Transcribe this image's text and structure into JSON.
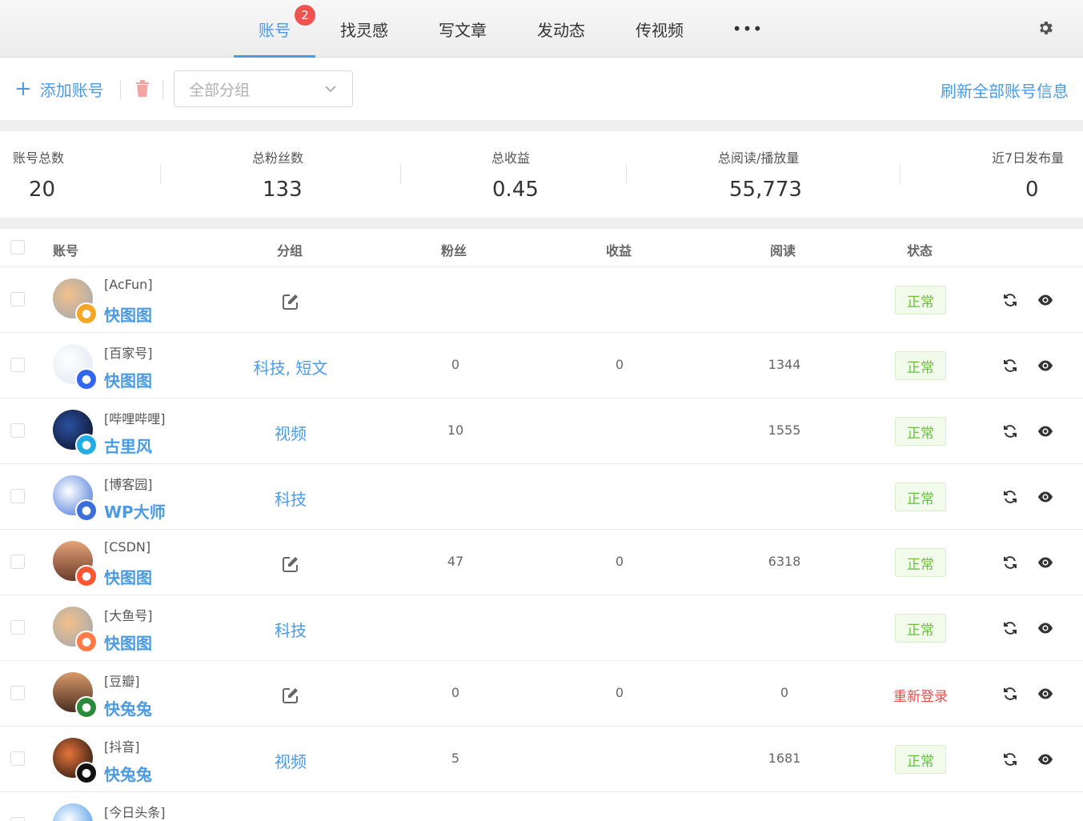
{
  "colors": {
    "accent": "#4a9be4",
    "badge": "#ef5350",
    "ok": "#67c23a",
    "danger": "#e05050"
  },
  "tabs": [
    {
      "label": "账号",
      "badge": "2"
    },
    {
      "label": "找灵感"
    },
    {
      "label": "写文章"
    },
    {
      "label": "发动态"
    },
    {
      "label": "传视频"
    },
    {
      "label": "•••"
    }
  ],
  "toolbar": {
    "add_label": "添加账号",
    "group_select": "全部分组",
    "refresh_all": "刷新全部账号信息"
  },
  "stats": [
    {
      "label": "账号总数",
      "value": "20"
    },
    {
      "label": "总粉丝数",
      "value": "133"
    },
    {
      "label": "总收益",
      "value": "0.45"
    },
    {
      "label": "总阅读/播放量",
      "value": "55,773"
    },
    {
      "label": "近7日发布量",
      "value": "0"
    }
  ],
  "table": {
    "headers": {
      "account": "账号",
      "group": "分组",
      "fans": "粉丝",
      "income": "收益",
      "reads": "阅读",
      "status": "状态"
    },
    "rows": [
      {
        "platform": "[AcFun]",
        "name": "快图图",
        "group": "",
        "fans": "",
        "income": "",
        "reads": "",
        "status": "正常"
      },
      {
        "platform": "[百家号]",
        "name": "快图图",
        "group": "科技, 短文",
        "fans": "0",
        "income": "0",
        "reads": "1344",
        "status": "正常"
      },
      {
        "platform": "[哔哩哔哩]",
        "name": "古里风",
        "group": "视频",
        "fans": "10",
        "income": "",
        "reads": "1555",
        "status": "正常"
      },
      {
        "platform": "[博客园]",
        "name": "WP大师",
        "group": "科技",
        "fans": "",
        "income": "",
        "reads": "",
        "status": "正常"
      },
      {
        "platform": "[CSDN]",
        "name": "快图图",
        "group": "",
        "fans": "47",
        "income": "0",
        "reads": "6318",
        "status": "正常"
      },
      {
        "platform": "[大鱼号]",
        "name": "快图图",
        "group": "科技",
        "fans": "",
        "income": "",
        "reads": "",
        "status": "正常"
      },
      {
        "platform": "[豆瓣]",
        "name": "快兔兔",
        "group": "",
        "fans": "0",
        "income": "0",
        "reads": "0",
        "status": "重新登录"
      },
      {
        "platform": "[抖音]",
        "name": "快兔兔",
        "group": "视频",
        "fans": "5",
        "income": "",
        "reads": "1681",
        "status": "正常"
      },
      {
        "platform": "[今日头条]",
        "name": "",
        "group": "",
        "fans": "",
        "income": "",
        "reads": "",
        "status": ""
      }
    ]
  }
}
